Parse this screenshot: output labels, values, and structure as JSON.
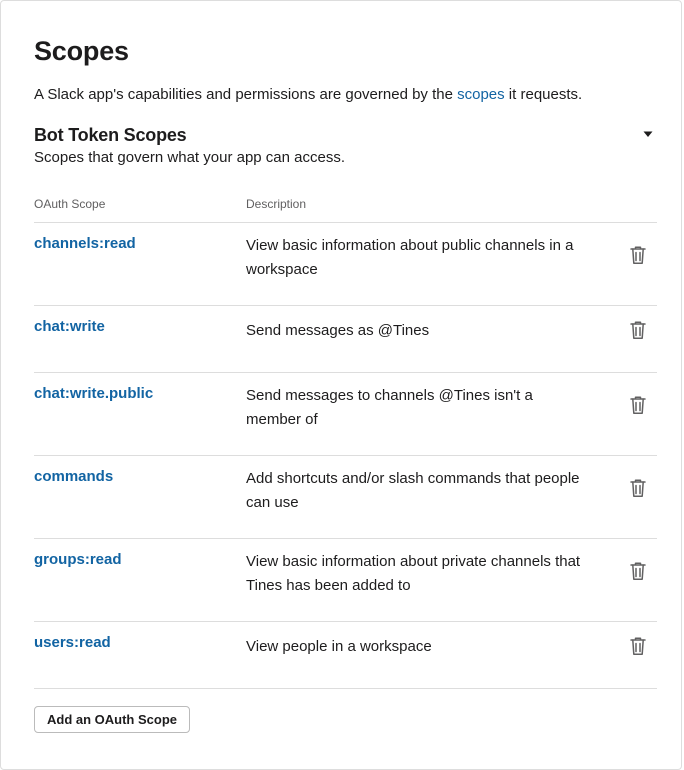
{
  "header": {
    "title": "Scopes",
    "intro_before": "A Slack app's capabilities and permissions are governed by the ",
    "intro_link": "scopes",
    "intro_after": " it requests."
  },
  "section": {
    "title": "Bot Token Scopes",
    "subtitle": "Scopes that govern what your app can access.",
    "toggle_icon": "caret-down-icon"
  },
  "table": {
    "columns": {
      "scope": "OAuth Scope",
      "description": "Description"
    },
    "rows": [
      {
        "scope": "channels:read",
        "description": "View basic information about public channels in a workspace"
      },
      {
        "scope": "chat:write",
        "description": "Send messages as @Tines"
      },
      {
        "scope": "chat:write.public",
        "description": "Send messages to channels @Tines isn't a member of"
      },
      {
        "scope": "commands",
        "description": "Add shortcuts and/or slash commands that people can use"
      },
      {
        "scope": "groups:read",
        "description": "View basic information about private channels that Tines has been added to"
      },
      {
        "scope": "users:read",
        "description": "View people in a workspace"
      }
    ],
    "row_action_icon": "trash-icon"
  },
  "actions": {
    "add_label": "Add an OAuth Scope"
  },
  "colors": {
    "link": "#1264a3",
    "text": "#1d1c1d",
    "muted": "#616061",
    "divider": "#dddddd"
  }
}
